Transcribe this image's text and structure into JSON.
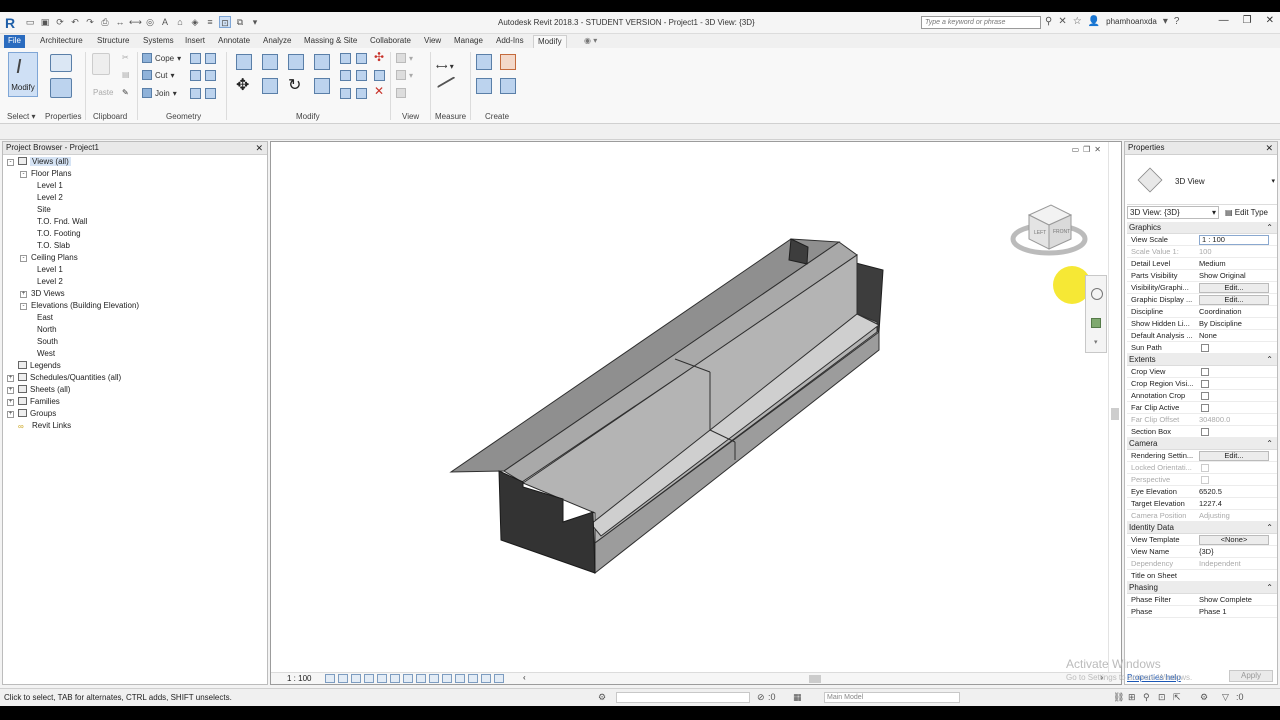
{
  "titlebar": {
    "title": "Autodesk Revit 2018.3 - STUDENT VERSION -    Project1 - 3D View: {3D}",
    "search_placeholder": "Type a keyword or phrase",
    "user": "phamhoanxda"
  },
  "tabs": [
    "File",
    "Architecture",
    "Structure",
    "Systems",
    "Insert",
    "Annotate",
    "Analyze",
    "Massing & Site",
    "Collaborate",
    "View",
    "Manage",
    "Add-Ins",
    "Modify"
  ],
  "ribbon": {
    "modify_label": "Modify",
    "select_label": "Select ▾",
    "properties_label": "Properties",
    "clipboard_label": "Clipboard",
    "paste_label": "Paste",
    "cope_label": "Cope",
    "cut_label": "Cut",
    "join_label": "Join",
    "geometry_label": "Geometry",
    "modify_panel_label": "Modify",
    "view_label": "View",
    "measure_label": "Measure",
    "create_label": "Create"
  },
  "browser": {
    "title": "Project Browser - Project1",
    "items": [
      {
        "label": "Views (all)",
        "level": 0,
        "toggle": "-",
        "icon": "view-icon",
        "selected": true
      },
      {
        "label": "Floor Plans",
        "level": 1,
        "toggle": "-"
      },
      {
        "label": "Level 1",
        "level": 2
      },
      {
        "label": "Level 2",
        "level": 2
      },
      {
        "label": "Site",
        "level": 2
      },
      {
        "label": "T.O. Fnd. Wall",
        "level": 2
      },
      {
        "label": "T.O. Footing",
        "level": 2
      },
      {
        "label": "T.O. Slab",
        "level": 2
      },
      {
        "label": "Ceiling Plans",
        "level": 1,
        "toggle": "-"
      },
      {
        "label": "Level 1",
        "level": 2
      },
      {
        "label": "Level 2",
        "level": 2
      },
      {
        "label": "3D Views",
        "level": 1,
        "toggle": "+"
      },
      {
        "label": "Elevations (Building Elevation)",
        "level": 1,
        "toggle": "-"
      },
      {
        "label": "East",
        "level": 2
      },
      {
        "label": "North",
        "level": 2
      },
      {
        "label": "South",
        "level": 2
      },
      {
        "label": "West",
        "level": 2
      },
      {
        "label": "Legends",
        "level": 0,
        "icon": "legend-icon"
      },
      {
        "label": "Schedules/Quantities (all)",
        "level": 0,
        "toggle": "+",
        "icon": "schedule-icon"
      },
      {
        "label": "Sheets (all)",
        "level": 0,
        "toggle": "+",
        "icon": "sheet-icon"
      },
      {
        "label": "Families",
        "level": 0,
        "toggle": "+",
        "icon": "family-icon"
      },
      {
        "label": "Groups",
        "level": 0,
        "toggle": "+",
        "icon": "group-icon"
      },
      {
        "label": "Revit Links",
        "level": 0,
        "icon": "link-icon"
      }
    ]
  },
  "view": {
    "scale": "1 : 100",
    "viewcube_left": "LEFT",
    "viewcube_front": "FRONT"
  },
  "properties": {
    "title": "Properties",
    "type_name": "3D View",
    "instance": "3D View: {3D}",
    "edit_type": "Edit Type",
    "sections": [
      {
        "title": "Graphics",
        "rows": [
          {
            "k": "View Scale",
            "v": "1 : 100",
            "kind": "box"
          },
          {
            "k": "Scale Value    1:",
            "v": "100",
            "dim": true
          },
          {
            "k": "Detail Level",
            "v": "Medium"
          },
          {
            "k": "Parts Visibility",
            "v": "Show Original"
          },
          {
            "k": "Visibility/Graphi...",
            "v": "Edit...",
            "kind": "btn"
          },
          {
            "k": "Graphic Display ...",
            "v": "Edit...",
            "kind": "btn"
          },
          {
            "k": "Discipline",
            "v": "Coordination"
          },
          {
            "k": "Show Hidden Li...",
            "v": "By Discipline"
          },
          {
            "k": "Default Analysis ...",
            "v": "None"
          },
          {
            "k": "Sun Path",
            "v": "",
            "kind": "chk"
          }
        ]
      },
      {
        "title": "Extents",
        "rows": [
          {
            "k": "Crop View",
            "v": "",
            "kind": "chk"
          },
          {
            "k": "Crop Region Visi...",
            "v": "",
            "kind": "chk"
          },
          {
            "k": "Annotation Crop",
            "v": "",
            "kind": "chk"
          },
          {
            "k": "Far Clip Active",
            "v": "",
            "kind": "chk"
          },
          {
            "k": "Far Clip Offset",
            "v": "304800.0",
            "dim": true
          },
          {
            "k": "Section Box",
            "v": "",
            "kind": "chk"
          }
        ]
      },
      {
        "title": "Camera",
        "rows": [
          {
            "k": "Rendering Settin...",
            "v": "Edit...",
            "kind": "btn"
          },
          {
            "k": "Locked Orientati...",
            "v": "",
            "kind": "chk",
            "dim": true
          },
          {
            "k": "Perspective",
            "v": "",
            "kind": "chk",
            "dim": true
          },
          {
            "k": "Eye Elevation",
            "v": "6520.5"
          },
          {
            "k": "Target Elevation",
            "v": "1227.4"
          },
          {
            "k": "Camera Position",
            "v": "Adjusting",
            "dim": true
          }
        ]
      },
      {
        "title": "Identity Data",
        "rows": [
          {
            "k": "View Template",
            "v": "<None>",
            "kind": "btn"
          },
          {
            "k": "View Name",
            "v": "{3D}"
          },
          {
            "k": "Dependency",
            "v": "Independent",
            "dim": true
          },
          {
            "k": "Title on Sheet",
            "v": ""
          }
        ]
      },
      {
        "title": "Phasing",
        "rows": [
          {
            "k": "Phase Filter",
            "v": "Show Complete"
          },
          {
            "k": "Phase",
            "v": "Phase 1"
          }
        ]
      }
    ],
    "help": "Properties help",
    "apply": "Apply"
  },
  "watermark": {
    "line1": "Activate Windows",
    "line2": "Go to Settings to activate Windows."
  },
  "status": {
    "text": "Click to select, TAB for alternates, CTRL adds, SHIFT unselects.",
    "filter_count": ":0",
    "model": "Main Model"
  }
}
